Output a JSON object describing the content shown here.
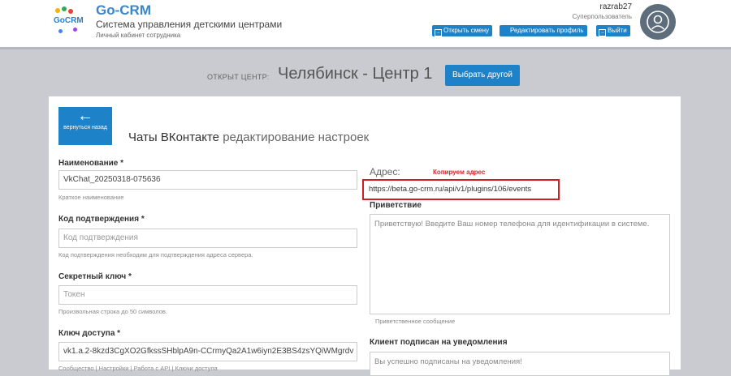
{
  "header": {
    "logo_text": "GoCRM",
    "app_title": "Go-CRM",
    "app_subtitle": "Система управления детскими центрами",
    "app_subtitle2": "Личный кабинет сотрудника",
    "user_name": "razrab27",
    "user_role": "Суперпользователь",
    "buttons": [
      {
        "label": "Открыть смену",
        "icon": "open-shift-icon"
      },
      {
        "label": "Редактировать профиль",
        "icon": ""
      },
      {
        "label": "Выйти",
        "icon": "logout-icon"
      }
    ],
    "avatar_icon": "user-avatar-icon"
  },
  "center": {
    "label": "ОТКРЫТ ЦЕНТР:",
    "name": "Челябинск - Центр 1",
    "choose_label": "Выбрать другой"
  },
  "page": {
    "back_label": "вернуться назад",
    "title": "Чаты ВКонтакте",
    "title_sub": "редактирование настроек"
  },
  "form": {
    "name": {
      "label": "Наименование *",
      "value": "VkChat_20250318-075636",
      "hint": "Краткое наименование"
    },
    "code": {
      "label": "Код подтверждения *",
      "placeholder": "Код подтверждения",
      "hint": "Код подтверждения необходим для подтверждения адреса сервера."
    },
    "secret": {
      "label": "Секретный ключ *",
      "placeholder": "Токен",
      "hint": "Произвольная строка до 50 символов."
    },
    "access": {
      "label": "Ключ доступа *",
      "value": "vk1.a.2-8kzd3CgXO2GfkssSHblpA9n-CCrmyQa2A1w6iyn2E3BS4zsYQiWMgrdv",
      "hint": "Сообщество | Настройки | Работа с API | Ключи доступа"
    },
    "address": {
      "label": "Адрес:",
      "annotation": "Копируем адрес",
      "value": "https://beta.go-crm.ru/api/v1/plugins/106/events"
    },
    "greeting": {
      "label": "Приветствие",
      "value": "Приветствую! Введите Ваш номер телефона для идентификации в системе.",
      "hint": "Приветственное сообщение"
    },
    "subscribed": {
      "label": "Клиент подписан на уведомления",
      "value": "Вы успешно подписаны на уведомления!"
    }
  },
  "colors": {
    "accent": "#1e82c8",
    "highlight": "#d11e25",
    "background": "#c9cbd0"
  }
}
